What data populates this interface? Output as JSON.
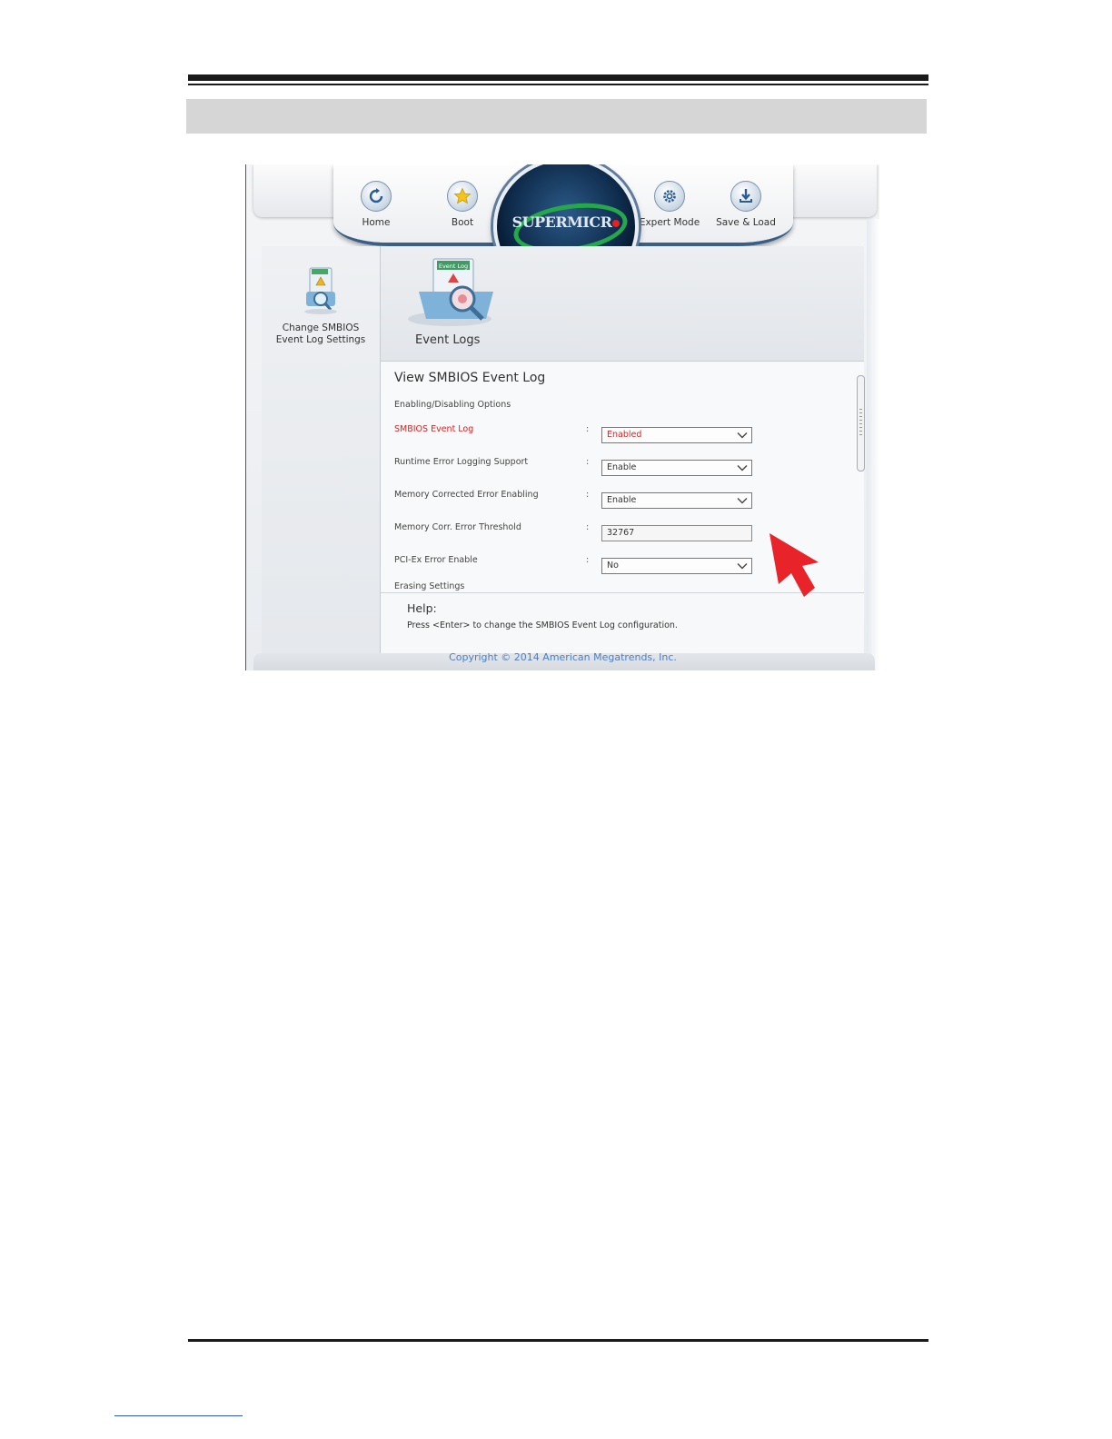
{
  "nav": {
    "home": "Home",
    "boot": "Boot",
    "expert": "Expert Mode",
    "save": "Save & Load"
  },
  "logo_text": "SUPERMICR",
  "sidebar": {
    "item_label_1": "Change SMBIOS",
    "item_label_2": "Event Log Settings",
    "icon_tag": "Event Log"
  },
  "page": {
    "title": "Event Logs",
    "icon_tag": "Event Log"
  },
  "content": {
    "section_title": "View SMBIOS Event Log",
    "subsection": "Enabling/Disabling Options",
    "rows": [
      {
        "label": "SMBIOS Event Log",
        "value": "Enabled"
      },
      {
        "label": "Runtime Error Logging Support",
        "value": "Enable"
      },
      {
        "label": "Memory Corrected Error Enabling",
        "value": "Enable"
      },
      {
        "label": "Memory Corr. Error Threshold",
        "value": "32767"
      },
      {
        "label": "PCI-Ex Error Enable",
        "value": "No"
      }
    ],
    "cut_label": "Erasing Settings"
  },
  "help": {
    "title": "Help:",
    "text": "Press <Enter> to change the SMBIOS Event Log configuration."
  },
  "copyright": "Copyright © 2014 American Megatrends, Inc.",
  "colors": {
    "active_red": "#e02020",
    "arrow_red": "#e8232a",
    "link_blue": "#4b7fc2"
  }
}
